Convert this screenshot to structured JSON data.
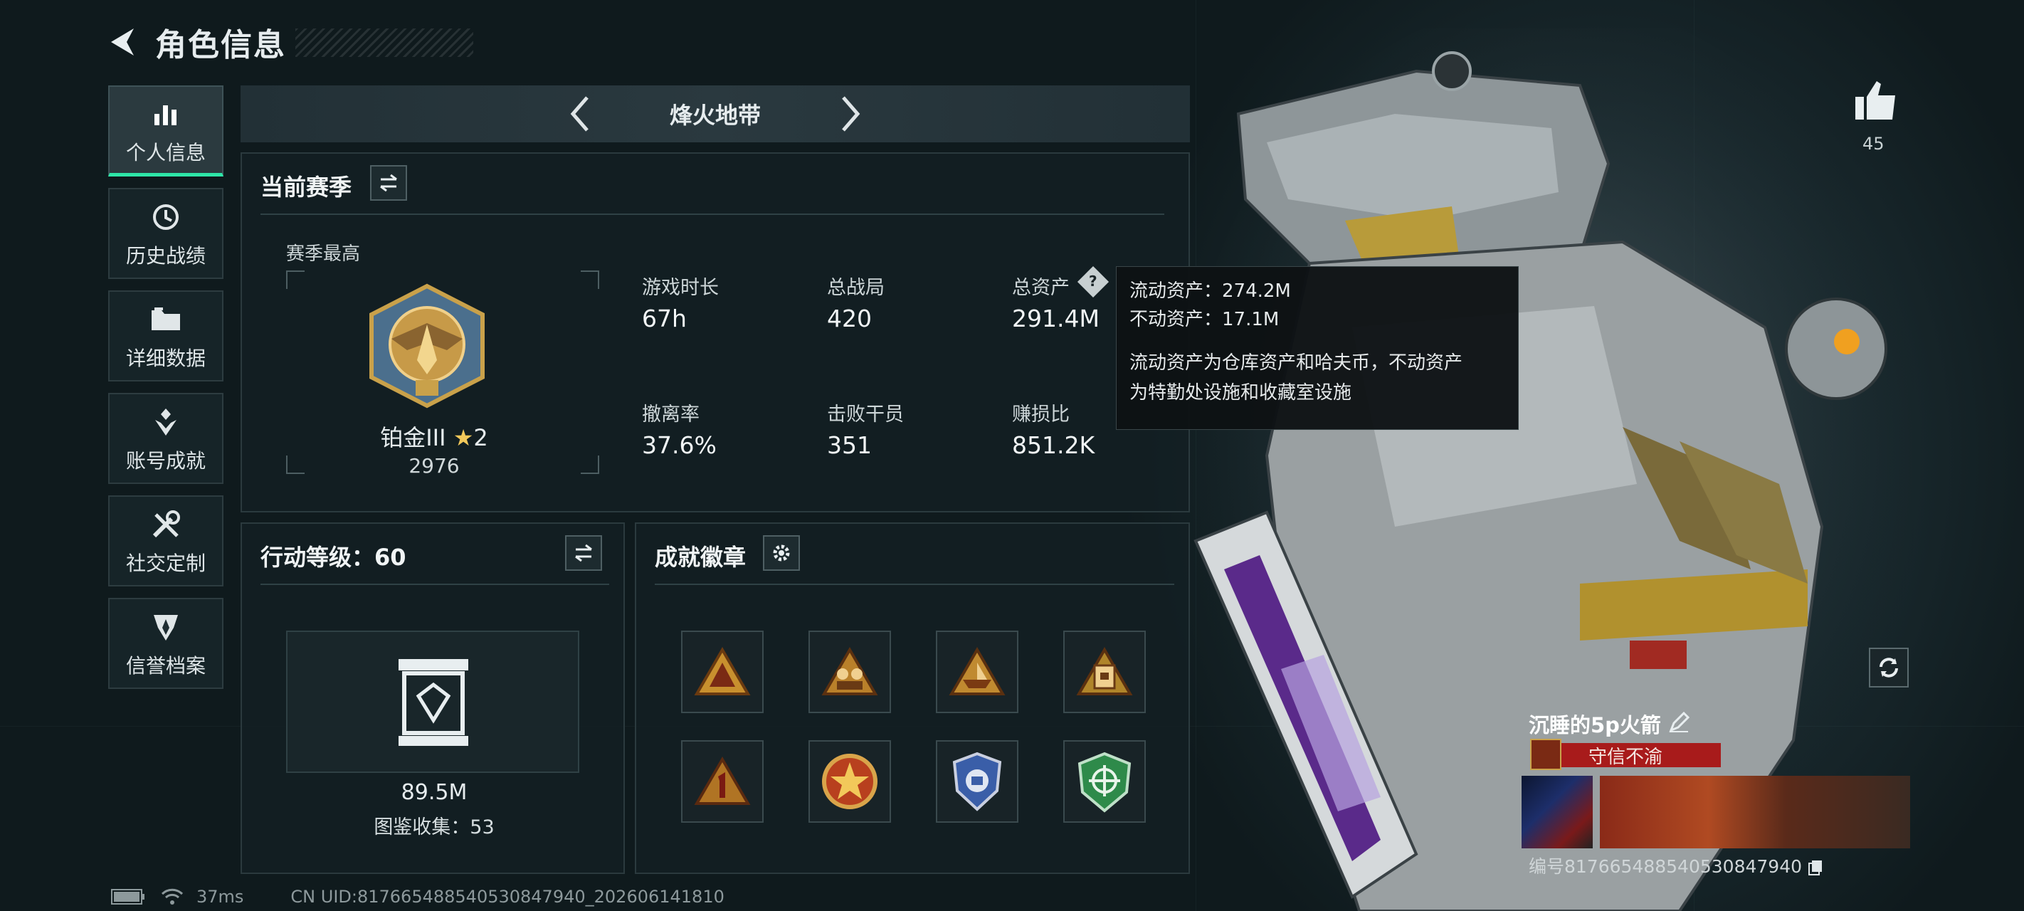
{
  "header": {
    "title": "角色信息"
  },
  "sidebar": {
    "items": [
      {
        "label": "个人信息",
        "icon": "bar-chart-icon",
        "active": true
      },
      {
        "label": "历史战绩",
        "icon": "history-clock-icon"
      },
      {
        "label": "详细数据",
        "icon": "folder-icon"
      },
      {
        "label": "账号成就",
        "icon": "achievement-icon"
      },
      {
        "label": "社交定制",
        "icon": "tools-icon"
      },
      {
        "label": "信誉档案",
        "icon": "reputation-icon"
      }
    ]
  },
  "mode_nav": {
    "title": "烽火地带"
  },
  "season": {
    "title": "当前赛季",
    "best_label": "赛季最高",
    "rank_name": "铂金III",
    "rank_stars": "2",
    "rank_score": "2976",
    "stats": [
      {
        "label": "游戏时长",
        "value": "67h"
      },
      {
        "label": "总战局",
        "value": "420"
      },
      {
        "label": "总资产",
        "value": "291.4M"
      },
      {
        "label": "撤离率",
        "value": "37.6%"
      },
      {
        "label": "击败干员",
        "value": "351"
      },
      {
        "label": "赚损比",
        "value": "851.2K"
      }
    ]
  },
  "tooltip": {
    "liquid": "流动资产：274.2M",
    "fixed": "不动资产：17.1M",
    "desc_line1": "流动资产为仓库资产和哈夫币，不动资产",
    "desc_line2": "为特勤处设施和收藏室设施"
  },
  "action_level": {
    "title": "行动等级：60",
    "collection_value": "89.5M",
    "collection_label": "图鉴收集：53"
  },
  "achievements": {
    "title": "成就徽章",
    "badges": [
      {
        "icon": "triangle-badge-icon",
        "color": "#c8902e"
      },
      {
        "icon": "soldiers-badge-icon",
        "color": "#b9802a"
      },
      {
        "icon": "ship-badge-icon",
        "color": "#c08a30"
      },
      {
        "icon": "fortress-badge-icon",
        "color": "#b0852a"
      },
      {
        "icon": "number-one-badge-icon",
        "color": "#b07424"
      },
      {
        "icon": "star-emblem-badge-icon",
        "color": "#b8401e"
      },
      {
        "icon": "shield-emblem-badge-icon",
        "color": "#3a5ea8"
      },
      {
        "icon": "crosshair-badge-icon",
        "color": "#2e8a4a"
      }
    ]
  },
  "social": {
    "like_count": "45"
  },
  "player": {
    "name": "沉睡的5p火箭",
    "title": "守信不渝",
    "id_text": "编号817665488540530847940"
  },
  "statusbar": {
    "ping": "37ms",
    "uid": "CN UID:817665488540530847940_202606141810"
  },
  "colors": {
    "accent": "#2ee6a8",
    "title_red": "#a81b1b"
  }
}
